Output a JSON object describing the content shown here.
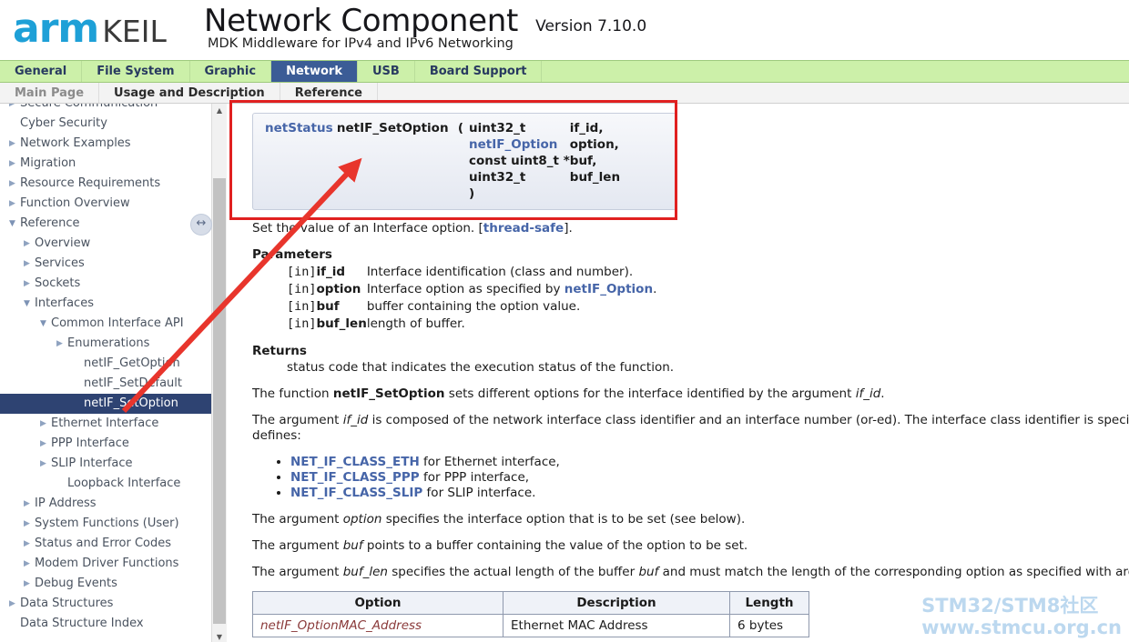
{
  "header": {
    "logo_arm": "arm",
    "logo_keil": "KEIL",
    "title": "Network Component",
    "version": "Version 7.10.0",
    "subtitle": "MDK Middleware for IPv4 and IPv6 Networking"
  },
  "tabs": [
    {
      "label": "General",
      "active": false
    },
    {
      "label": "File System",
      "active": false
    },
    {
      "label": "Graphic",
      "active": false
    },
    {
      "label": "Network",
      "active": true
    },
    {
      "label": "USB",
      "active": false
    },
    {
      "label": "Board Support",
      "active": false
    }
  ],
  "subtabs": [
    {
      "label": "Main Page"
    },
    {
      "label": "Usage and Description"
    },
    {
      "label": "Reference"
    }
  ],
  "sidebar": {
    "splitter_icon": "left-right-arrow-icon",
    "scroll_up_icon": "▲",
    "scroll_down_icon": "▼",
    "items": [
      {
        "label": "Secure Communication",
        "level": 0,
        "arrow": "collapsed",
        "selected": false
      },
      {
        "label": "Cyber Security",
        "level": 0,
        "arrow": "none",
        "selected": false
      },
      {
        "label": "Network Examples",
        "level": 0,
        "arrow": "collapsed",
        "selected": false
      },
      {
        "label": "Migration",
        "level": 0,
        "arrow": "collapsed",
        "selected": false
      },
      {
        "label": "Resource Requirements",
        "level": 0,
        "arrow": "collapsed",
        "selected": false
      },
      {
        "label": "Function Overview",
        "level": 0,
        "arrow": "collapsed",
        "selected": false
      },
      {
        "label": "Reference",
        "level": 0,
        "arrow": "expanded",
        "selected": false
      },
      {
        "label": "Overview",
        "level": 1,
        "arrow": "collapsed",
        "selected": false
      },
      {
        "label": "Services",
        "level": 1,
        "arrow": "collapsed",
        "selected": false
      },
      {
        "label": "Sockets",
        "level": 1,
        "arrow": "collapsed",
        "selected": false
      },
      {
        "label": "Interfaces",
        "level": 1,
        "arrow": "expanded",
        "selected": false
      },
      {
        "label": "Common Interface API",
        "level": 2,
        "arrow": "expanded",
        "selected": false
      },
      {
        "label": "Enumerations",
        "level": 3,
        "arrow": "collapsed",
        "selected": false
      },
      {
        "label": "netIF_GetOption",
        "level": 4,
        "arrow": "none",
        "selected": false
      },
      {
        "label": "netIF_SetDefault",
        "level": 4,
        "arrow": "none",
        "selected": false
      },
      {
        "label": "netIF_SetOption",
        "level": 4,
        "arrow": "none",
        "selected": true
      },
      {
        "label": "Ethernet Interface",
        "level": 2,
        "arrow": "collapsed",
        "selected": false
      },
      {
        "label": "PPP Interface",
        "level": 2,
        "arrow": "collapsed",
        "selected": false
      },
      {
        "label": "SLIP Interface",
        "level": 2,
        "arrow": "collapsed",
        "selected": false
      },
      {
        "label": "Loopback Interface",
        "level": 3,
        "arrow": "none",
        "selected": false
      },
      {
        "label": "IP Address",
        "level": 1,
        "arrow": "collapsed",
        "selected": false
      },
      {
        "label": "System Functions (User)",
        "level": 1,
        "arrow": "collapsed",
        "selected": false
      },
      {
        "label": "Status and Error Codes",
        "level": 1,
        "arrow": "collapsed",
        "selected": false
      },
      {
        "label": "Modem Driver Functions",
        "level": 1,
        "arrow": "collapsed",
        "selected": false
      },
      {
        "label": "Debug Events",
        "level": 1,
        "arrow": "collapsed",
        "selected": false
      },
      {
        "label": "Data Structures",
        "level": 0,
        "arrow": "collapsed",
        "selected": false
      },
      {
        "label": "Data Structure Index",
        "level": 0,
        "arrow": "none",
        "selected": false
      }
    ]
  },
  "signature": {
    "return_type": "netStatus",
    "function_name": "netIF_SetOption",
    "open_paren": "(",
    "close_paren": ")",
    "args": [
      {
        "type": "uint32_t",
        "name": "if_id,",
        "type_is_link": false
      },
      {
        "type": "netIF_Option",
        "name": "option,",
        "type_is_link": true
      },
      {
        "type": "const uint8_t *",
        "name": "buf,",
        "type_is_link": false
      },
      {
        "type": "uint32_t",
        "name": "buf_len",
        "type_is_link": false
      }
    ]
  },
  "content": {
    "intro_pre": "Set the value of an Interface option. [",
    "intro_link": "thread-safe",
    "intro_post": "].",
    "parameters_heading": "Parameters",
    "parameters": [
      {
        "dir": "[in]",
        "name": "if_id",
        "desc_pre": "Interface identification (class and number).",
        "desc_link": "",
        "desc_post": ""
      },
      {
        "dir": "[in]",
        "name": "option",
        "desc_pre": "Interface option as specified by ",
        "desc_link": "netIF_Option",
        "desc_post": "."
      },
      {
        "dir": "[in]",
        "name": "buf",
        "desc_pre": "buffer containing the option value.",
        "desc_link": "",
        "desc_post": ""
      },
      {
        "dir": "[in]",
        "name": "buf_len",
        "desc_pre": "length of buffer.",
        "desc_link": "",
        "desc_post": ""
      }
    ],
    "returns_heading": "Returns",
    "returns_body": "status code that indicates the execution status of the function.",
    "para_function": {
      "pre": "The function ",
      "bold": "netIF_SetOption",
      "mid": " sets different options for the interface identified by the argument ",
      "ital": "if_id",
      "post": "."
    },
    "para_ifid": {
      "pre": "The argument ",
      "ital": "if_id",
      "post": " is composed of the network interface class identifier and an interface number (or-ed). The interface class identifier is specified with the following",
      "line2": "defines:"
    },
    "bullets": [
      {
        "code": "NET_IF_CLASS_ETH",
        "text": " for Ethernet interface,"
      },
      {
        "code": "NET_IF_CLASS_PPP",
        "text": " for PPP interface,"
      },
      {
        "code": "NET_IF_CLASS_SLIP",
        "text": " for SLIP interface."
      }
    ],
    "para_option": {
      "pre": "The argument ",
      "ital": "option",
      "post": " specifies the interface option that is to be set (see below)."
    },
    "para_buf": {
      "pre": "The argument ",
      "ital": "buf",
      "post": " points to a buffer containing the value of the option to be set."
    },
    "para_buflen": {
      "pre": "The argument ",
      "ital": "buf_len",
      "mid": " specifies the actual length of the buffer ",
      "ital2": "buf",
      "post": " and must match the length of the corresponding option as specified with argument"
    },
    "options_table": {
      "headers": [
        "Option",
        "Description",
        "Length"
      ],
      "rows": [
        {
          "option": "netIF_OptionMAC_Address",
          "description": "Ethernet MAC Address",
          "length": "6 bytes"
        }
      ]
    }
  },
  "watermark": {
    "line1": "STM32/STM8社区",
    "line2": "www.stmcu.org.cn",
    "color": "#bcd8ef"
  },
  "annotations": {
    "box_color": "#e02020",
    "arrow_color": "#e8352c"
  }
}
